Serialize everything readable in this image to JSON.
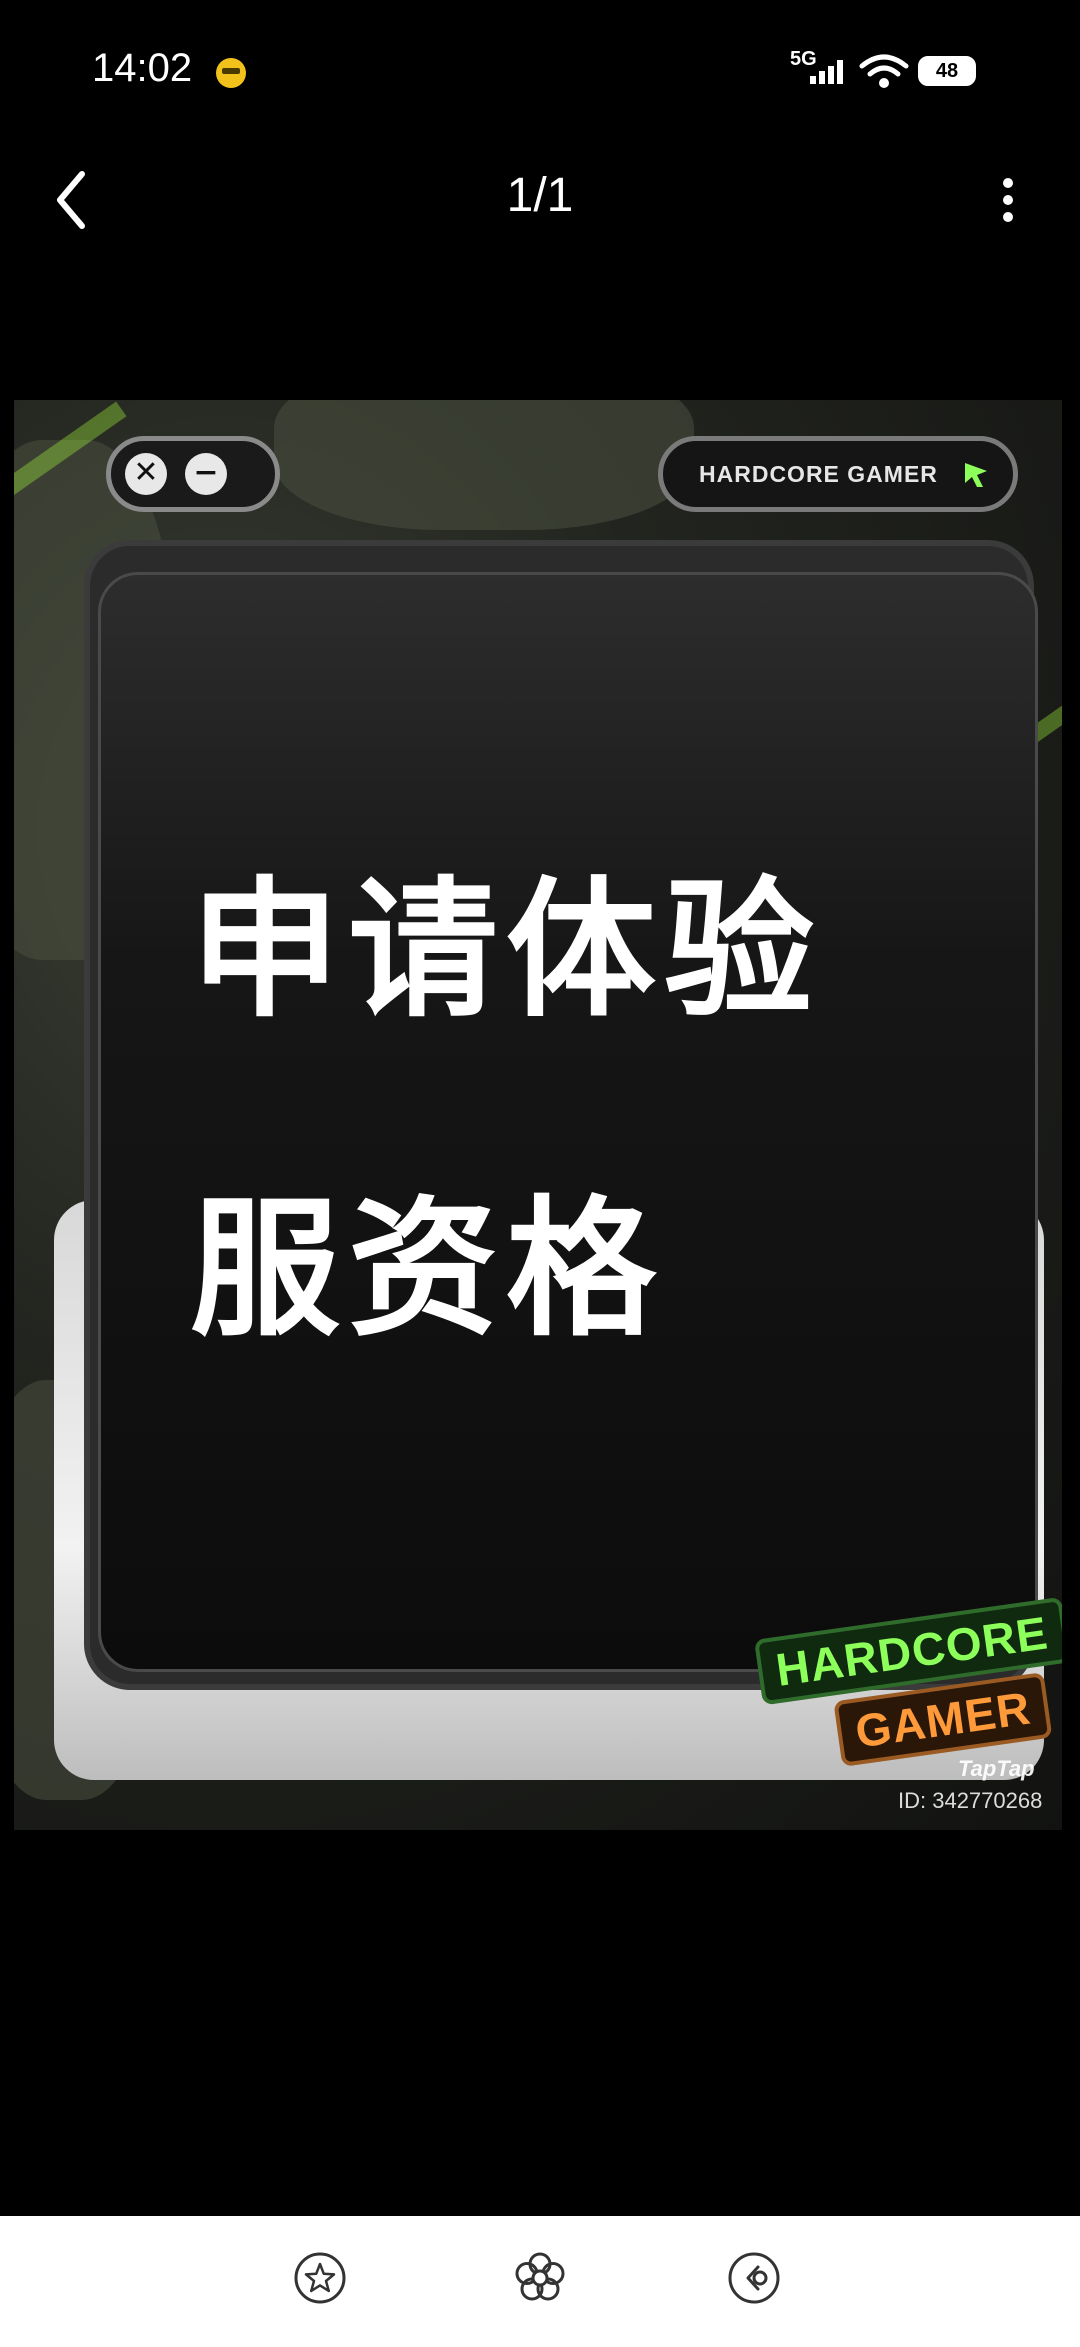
{
  "status_bar": {
    "time": "14:02",
    "network": "5G",
    "battery": "48",
    "icons": [
      "emoji-notification-icon",
      "signal-icon",
      "wifi-icon",
      "battery-icon"
    ]
  },
  "nav": {
    "back_icon": "chevron-left-icon",
    "page_counter": "1/1",
    "more_icon": "vertical-ellipsis-icon"
  },
  "image": {
    "headline_line1": "申请体验",
    "headline_line2": "服资格",
    "window_btn_close": "✕",
    "window_btn_minimize": "−",
    "badge_text": "HARDCORE GAMER",
    "logo_line1": "HARDCORE",
    "logo_line2": "GAMER",
    "watermark_brand": "TapTap",
    "watermark_id": "ID: 342770268",
    "accent_green": "#8dff5a",
    "accent_orange": "#ff9a3a"
  },
  "toolbar": {
    "icons": [
      "star-icon",
      "flower-icon",
      "share-icon"
    ]
  }
}
